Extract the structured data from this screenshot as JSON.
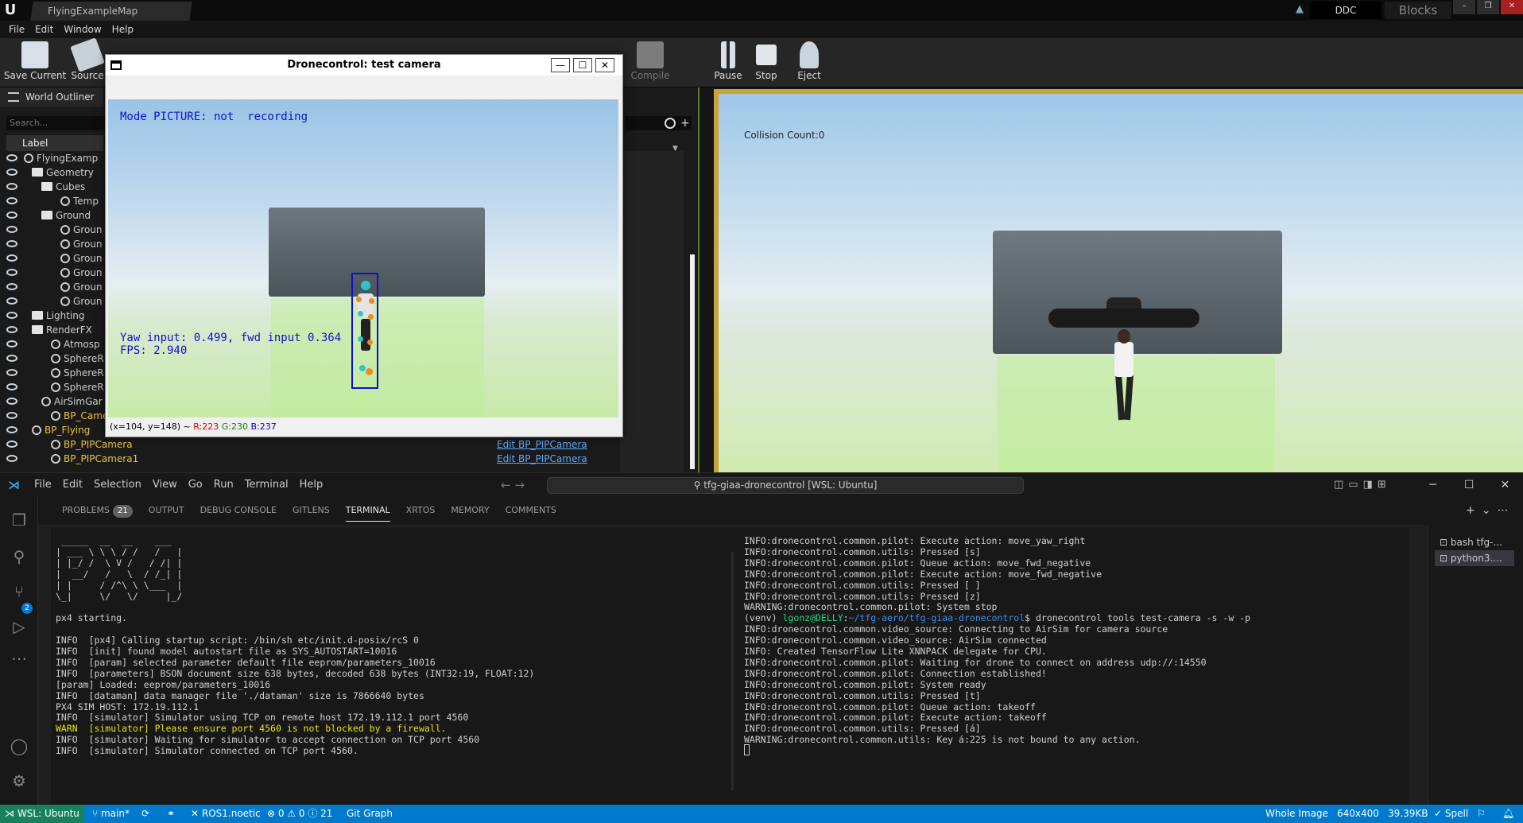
{
  "ue": {
    "doc_tab": "FlyingExampleMap",
    "menu": [
      "File",
      "Edit",
      "Window",
      "Help"
    ],
    "ddc": "DDC",
    "project": "Blocks",
    "toolbar": {
      "save": "Save Current",
      "source": "Source",
      "compile": "Compile",
      "pause": "Pause",
      "stop": "Stop",
      "eject": "Eject"
    },
    "outliner": {
      "title": "World Outliner",
      "search_placeholder": "Search...",
      "label_header": "Label",
      "rows": [
        {
          "label": "FlyingExamp",
          "type": ""
        },
        {
          "label": "Geometry",
          "type": ""
        },
        {
          "label": "Cubes",
          "type": ""
        },
        {
          "label": "Temp",
          "type": ""
        },
        {
          "label": "Ground",
          "type": ""
        },
        {
          "label": "Groun",
          "type": ""
        },
        {
          "label": "Groun",
          "type": ""
        },
        {
          "label": "Groun",
          "type": ""
        },
        {
          "label": "Groun",
          "type": ""
        },
        {
          "label": "Groun",
          "type": ""
        },
        {
          "label": "Groun",
          "type": ""
        },
        {
          "label": "Lighting",
          "type": ""
        },
        {
          "label": "RenderFX",
          "type": ""
        },
        {
          "label": "Atmosp",
          "type": ""
        },
        {
          "label": "SphereR",
          "type": ""
        },
        {
          "label": "SphereR",
          "type": ""
        },
        {
          "label": "SphereR",
          "type": ""
        },
        {
          "label": "AirSimGar",
          "type": ""
        },
        {
          "label": "BP_Camer",
          "type": ""
        },
        {
          "label": "BP_Flying",
          "type": ""
        },
        {
          "label": "BP_PIPCamera",
          "type": "Edit BP_PIPCamera"
        },
        {
          "label": "BP_PIPCamera1",
          "type": "Edit BP_PIPCamera"
        }
      ]
    },
    "viewport": {
      "collision": "Collision Count:0"
    }
  },
  "dronecontrol": {
    "title": "Dronecontrol: test camera",
    "min": "—",
    "max": "☐",
    "close": "✕",
    "mode_text": "Mode PICTURE: not  recording",
    "yaw_text": "Yaw input: 0.499, fwd input 0.364",
    "fps_text": "FPS: 2.940",
    "status_coords": "(x=104, y=148) ~ ",
    "status_r": "R:223",
    "status_g": "G:230",
    "status_b": "B:237"
  },
  "vscode": {
    "menu": [
      "File",
      "Edit",
      "Selection",
      "View",
      "Go",
      "Run",
      "Terminal",
      "Help"
    ],
    "command_center": "tfg-giaa-dronecontrol [WSL: Ubuntu]",
    "scm_badge": "2",
    "tabs": {
      "problems": "PROBLEMS",
      "problems_count": "21",
      "output": "OUTPUT",
      "debug": "DEBUG CONSOLE",
      "gitlens": "GITLENS",
      "terminal": "TERMINAL",
      "xrtos": "XRTOS",
      "memory": "MEMORY",
      "comments": "COMMENTS"
    },
    "term_list": [
      "bash  tfg-...",
      "python3...."
    ],
    "term_left": [
      " _____  __  __    ___",
      "| ___ \\ \\ \\ / /   /   |",
      "| |_/ /  \\ V /   / /| |",
      "|  __/   /   \\  / /_| |",
      "| |     / /^\\ \\ \\___  |",
      "\\_|     \\/   \\/     |_/",
      "",
      "px4 starting.",
      "",
      "INFO  [px4] Calling startup script: /bin/sh etc/init.d-posix/rcS 0",
      "INFO  [init] found model autostart file as SYS_AUTOSTART=10016",
      "INFO  [param] selected parameter default file eeprom/parameters_10016",
      "INFO  [parameters] BSON document size 638 bytes, decoded 638 bytes (INT32:19, FLOAT:12)",
      "[param] Loaded: eeprom/parameters_10016",
      "INFO  [dataman] data manager file './dataman' size is 7866640 bytes",
      "PX4 SIM HOST: 172.19.112.1",
      "INFO  [simulator] Simulator using TCP on remote host 172.19.112.1 port 4560",
      "WARN  [simulator] Please ensure port 4560 is not blocked by a firewall.",
      "INFO  [simulator] Waiting for simulator to accept connection on TCP port 4560",
      "INFO  [simulator] Simulator connected on TCP port 4560."
    ],
    "term_right": [
      "INFO:dronecontrol.common.pilot: Execute action: move_yaw_right",
      "INFO:dronecontrol.common.utils: Pressed [s]",
      "INFO:dronecontrol.common.pilot: Queue action: move_fwd_negative",
      "INFO:dronecontrol.common.pilot: Execute action: move_fwd_negative",
      "INFO:dronecontrol.common.utils: Pressed [ ]",
      "INFO:dronecontrol.common.utils: Pressed [z]",
      "WARNING:dronecontrol.common.pilot: System stop",
      "",
      "INFO:dronecontrol.common.video_source: Connecting to AirSim for camera source",
      "INFO:dronecontrol.common.video_source: AirSim connected",
      "INFO: Created TensorFlow Lite XNNPACK delegate for CPU.",
      "INFO:dronecontrol.common.pilot: Waiting for drone to connect on address udp://:14550",
      "INFO:dronecontrol.common.pilot: Connection established!",
      "INFO:dronecontrol.common.pilot: System ready",
      "INFO:dronecontrol.common.utils: Pressed [t]",
      "INFO:dronecontrol.common.pilot: Queue action: takeoff",
      "INFO:dronecontrol.common.pilot: Execute action: takeoff",
      "INFO:dronecontrol.common.utils: Pressed [á]",
      "WARNING:dronecontrol.common.utils: Key á:225 is not bound to any action."
    ],
    "prompt": {
      "venv": "(venv) ",
      "user": "lgonz@DELLY",
      "colon": ":",
      "path": "~/tfg-aero/tfg-giaa-dronecontrol",
      "cmd": "$ dronecontrol tools test-camera -s -w -p"
    },
    "status": {
      "remote": "WSL: Ubuntu",
      "branch": "main*",
      "ros": "ROS1.noetic",
      "problems": "⊗ 0 ⚠ 0 ⓘ 21",
      "gitgraph": "Git Graph",
      "whole_image": "Whole Image",
      "dims": "640x400",
      "size": "39.39KB",
      "spell": "Spell"
    }
  }
}
